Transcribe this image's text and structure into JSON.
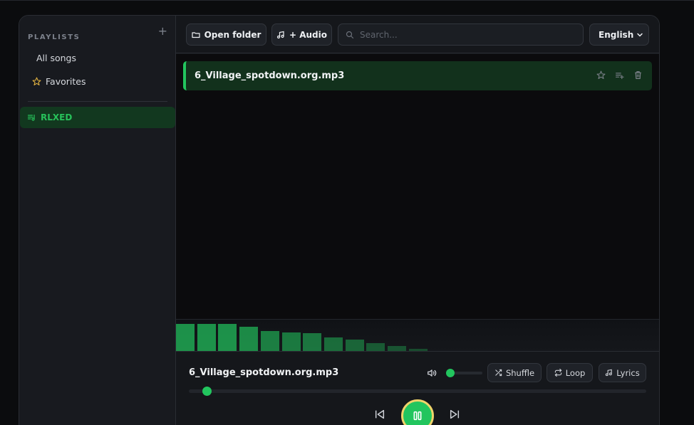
{
  "sidebar": {
    "playlists_title": "PLAYLISTS",
    "add_symbol": "+",
    "all_songs": "All songs",
    "favorites": "Favorites",
    "playlists": [
      {
        "label": "RLXED",
        "active": true
      }
    ]
  },
  "toolbar": {
    "open_folder": "Open folder",
    "add_audio": "+ Audio",
    "search_placeholder": "Search...",
    "language": "English"
  },
  "tracks": [
    {
      "title": "6_Village_spotdown.org.mp3",
      "active": true
    }
  ],
  "player": {
    "now_playing": "6_Village_spotdown.org.mp3",
    "volume_fraction": 0.0,
    "progress_fraction": 0.03,
    "shuffle": "Shuffle",
    "loop": "Loop",
    "lyrics": "Lyrics",
    "is_playing": true
  },
  "visualizer": {
    "levels": [
      0.92,
      0.92,
      0.92,
      0.84,
      0.69,
      0.63,
      0.6,
      0.47,
      0.38,
      0.26,
      0.17,
      0.07
    ]
  },
  "colors": {
    "accent": "#22c55e",
    "accent_dark": "#12381f",
    "favorite_star": "#e3b341",
    "play_ring": "#f0d36a"
  },
  "icons": [
    "plus-icon",
    "star-icon",
    "playlist-icon",
    "folder-icon",
    "music-note-icon",
    "search-icon",
    "chevron-down-icon",
    "trash-icon",
    "queue-icon",
    "volume-icon",
    "shuffle-icon",
    "loop-icon",
    "pause-icon",
    "skip-previous-icon",
    "skip-next-icon"
  ]
}
